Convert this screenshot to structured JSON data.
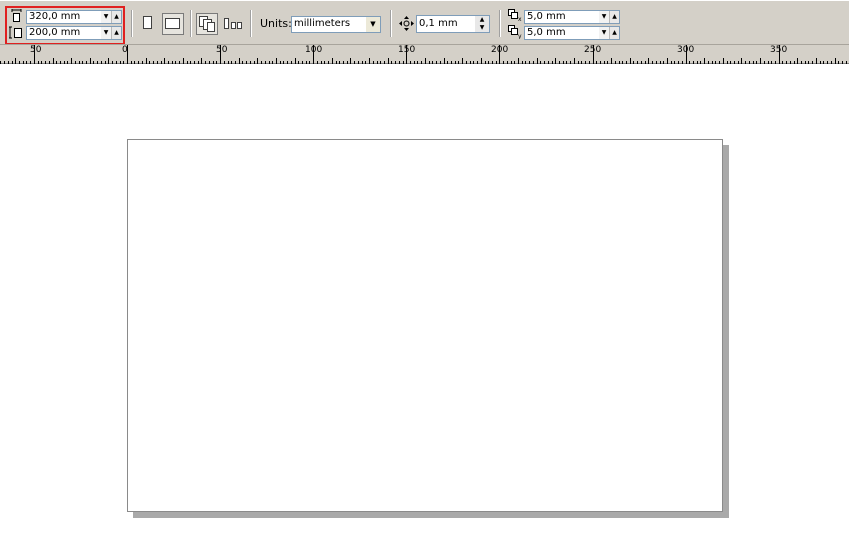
{
  "page_size": {
    "width_value": "320,0 mm",
    "height_value": "200,0 mm"
  },
  "orientation": {
    "portrait_icon": "portrait-page-icon",
    "landscape_icon": "landscape-page-icon",
    "selected": "landscape"
  },
  "layout": {
    "all_pages_icon": "all-pages-size-icon",
    "current_page_icon": "current-page-size-icon"
  },
  "units": {
    "label": "Units:",
    "value": "millimeters"
  },
  "nudge": {
    "value": "0,1 mm"
  },
  "duplicate_distance": {
    "x_value": "5,0 mm",
    "y_value": "5,0 mm"
  },
  "ruler": {
    "labels": [
      "50",
      "0",
      "50",
      "100",
      "150",
      "200",
      "250",
      "300",
      "350"
    ]
  },
  "colors": {
    "highlight": "#e02020",
    "toolbar": "#d4d0c8"
  }
}
